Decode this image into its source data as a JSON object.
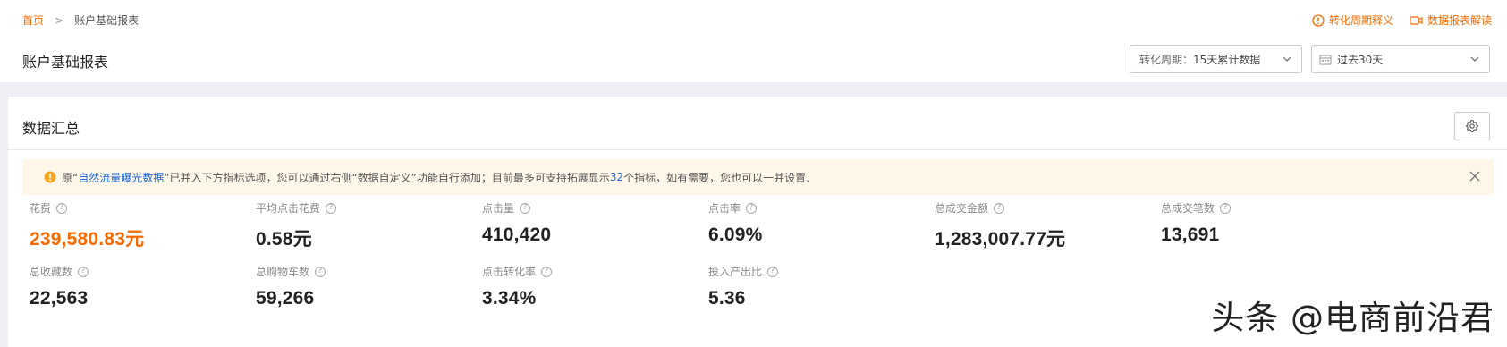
{
  "breadcrumb": {
    "home": "首页",
    "separator": ">",
    "current": "账户基础报表"
  },
  "top_links": {
    "period_help": "转化周期释义",
    "report_help": "数据报表解读"
  },
  "page_title": "账户基础报表",
  "filters": {
    "period_label": "转化周期：",
    "period_value": "15天累计数据",
    "date_range": "过去30天"
  },
  "summary": {
    "title": "数据汇总",
    "notice": {
      "prefix": "原“",
      "highlight": "自然流量曝光数据",
      "middle": "”已并入下方指标选项，您可以通过右侧“数据自定义”功能自行添加；目前最多可支持拓展显示",
      "count": "32",
      "suffix": "个指标，如有需要，您也可以一并设置."
    },
    "metrics": [
      {
        "label": "花费",
        "value": "239,580.83元",
        "primary": true
      },
      {
        "label": "平均点击花费",
        "value": "0.58元"
      },
      {
        "label": "点击量",
        "value": "410,420"
      },
      {
        "label": "点击率",
        "value": "6.09%"
      },
      {
        "label": "总成交金额",
        "value": "1,283,007.77元"
      },
      {
        "label": "总成交笔数",
        "value": "13,691"
      },
      {
        "label": "总收藏数",
        "value": "22,563"
      },
      {
        "label": "总购物车数",
        "value": "59,266"
      },
      {
        "label": "点击转化率",
        "value": "3.34%"
      },
      {
        "label": "投入产出比",
        "value": "5.36"
      }
    ]
  },
  "watermark": "头条 @电商前沿君",
  "colors": {
    "accent": "#f56a00",
    "link_blue": "#1a66d6",
    "notice_bg": "#fef6e8",
    "page_bg": "#eef0f5"
  }
}
